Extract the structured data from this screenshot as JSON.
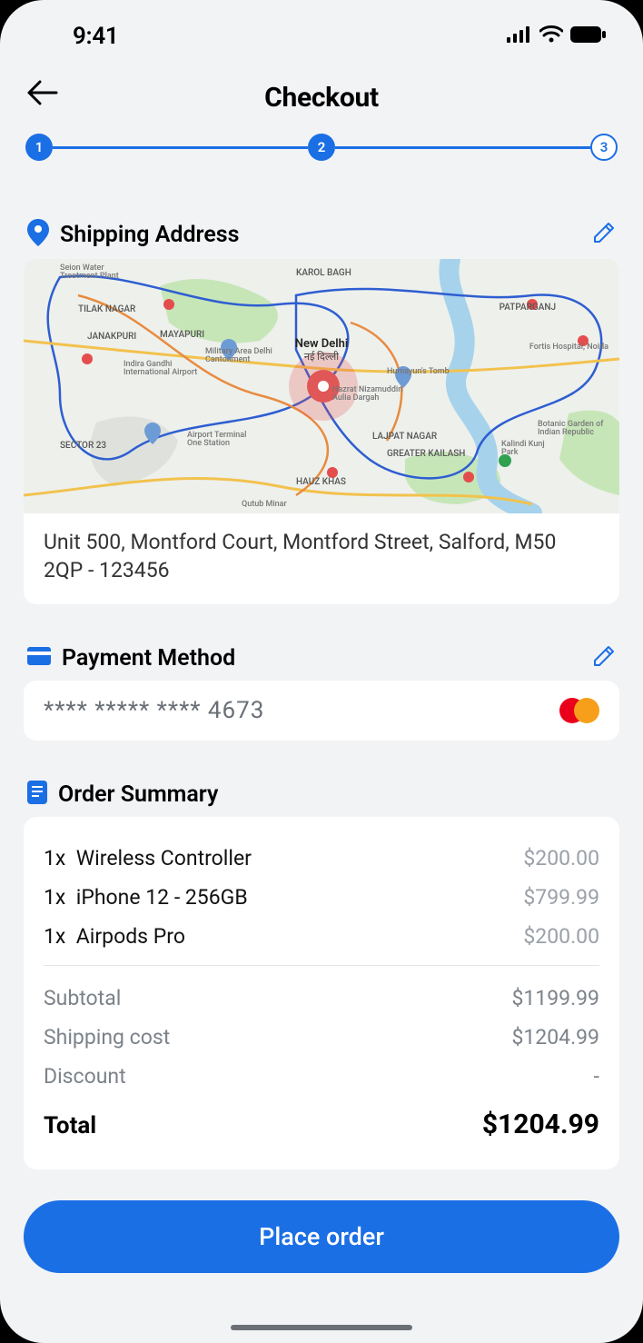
{
  "status": {
    "time": "9:41"
  },
  "header": {
    "title": "Checkout"
  },
  "stepper": {
    "s1": "1",
    "s2": "2",
    "s3": "3"
  },
  "shipping": {
    "title": "Shipping Address",
    "address": "Unit 500, Montford Court, Montford Street, Salford, M50 2QP - 123456",
    "map_center_label": "New Delhi",
    "map_center_sub": "नई दिल्ली",
    "labels": {
      "janakpuri": "JANAKPURI",
      "mayapuri": "MAYAPURI",
      "patparganj": "PATPARGANJ",
      "lajpat": "LAJPAT NAGAR",
      "greater": "GREATER KAILASH",
      "hauz": "HAUZ KHAS",
      "sector": "SECTOR 23",
      "tilak": "TILAK NAGAR",
      "karol": "KAROL BAGH",
      "qutub": "Qutub Minar",
      "airport": "Indira Gandhi International Airport",
      "military": "Military Area Delhi Cantonment",
      "fortis": "Fortis Hospital, Noida",
      "botanic": "Botanic Garden of Indian Republic",
      "kalindi": "Kalindi Kunj Park",
      "humayun": "Humayun's Tomb",
      "nizam": "Hazrat Nizamuddin Aulia Dargah",
      "seion": "Seion Water Treatment Plant",
      "terminal": "Airport Terminal One Station"
    }
  },
  "payment": {
    "title": "Payment Method",
    "masked_number": "**** ***** **** 4673",
    "brand": "mastercard"
  },
  "summary": {
    "title": "Order Summary",
    "items": [
      {
        "qty": "1x",
        "name": "Wireless Controller",
        "price": "$200.00"
      },
      {
        "qty": "1x",
        "name": "iPhone 12 - 256GB",
        "price": "$799.99"
      },
      {
        "qty": "1x",
        "name": "Airpods Pro",
        "price": "$200.00"
      }
    ],
    "subtotal_label": "Subtotal",
    "subtotal_value": "$1199.99",
    "shipping_label": "Shipping cost",
    "shipping_value": "$1204.99",
    "discount_label": "Discount",
    "discount_value": "-",
    "total_label": "Total",
    "total_value": "$1204.99"
  },
  "cta": {
    "place_order": "Place order"
  },
  "colors": {
    "accent": "#1b6fe5"
  }
}
